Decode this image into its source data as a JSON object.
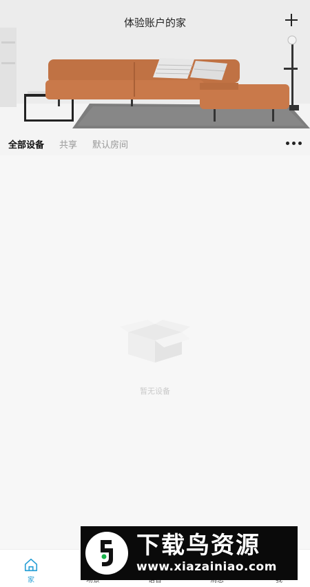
{
  "header": {
    "title": "体验账户的家",
    "add_icon": "plus-icon",
    "more_icon": "more-dots-icon"
  },
  "tabs": [
    {
      "label": "全部设备",
      "active": true
    },
    {
      "label": "共享",
      "active": false
    },
    {
      "label": "默认房间",
      "active": false
    }
  ],
  "empty_state": {
    "icon": "empty-box-icon",
    "text": "暂无设备"
  },
  "bottom_nav": [
    {
      "label": "家",
      "icon": "home-icon",
      "active": true
    },
    {
      "label": "场景",
      "icon": "scene-icon",
      "active": false
    },
    {
      "label": "语音",
      "icon": "voice-icon",
      "active": false
    },
    {
      "label": "消息",
      "icon": "message-icon",
      "active": false
    },
    {
      "label": "我",
      "icon": "me-icon",
      "active": false
    }
  ],
  "watermark": {
    "title": "下载鸟资源",
    "url": "www.xiazainiao.com"
  },
  "colors": {
    "accent": "#2aa0d6",
    "sofa": "#c9794a",
    "background": "#f7f7f7"
  }
}
